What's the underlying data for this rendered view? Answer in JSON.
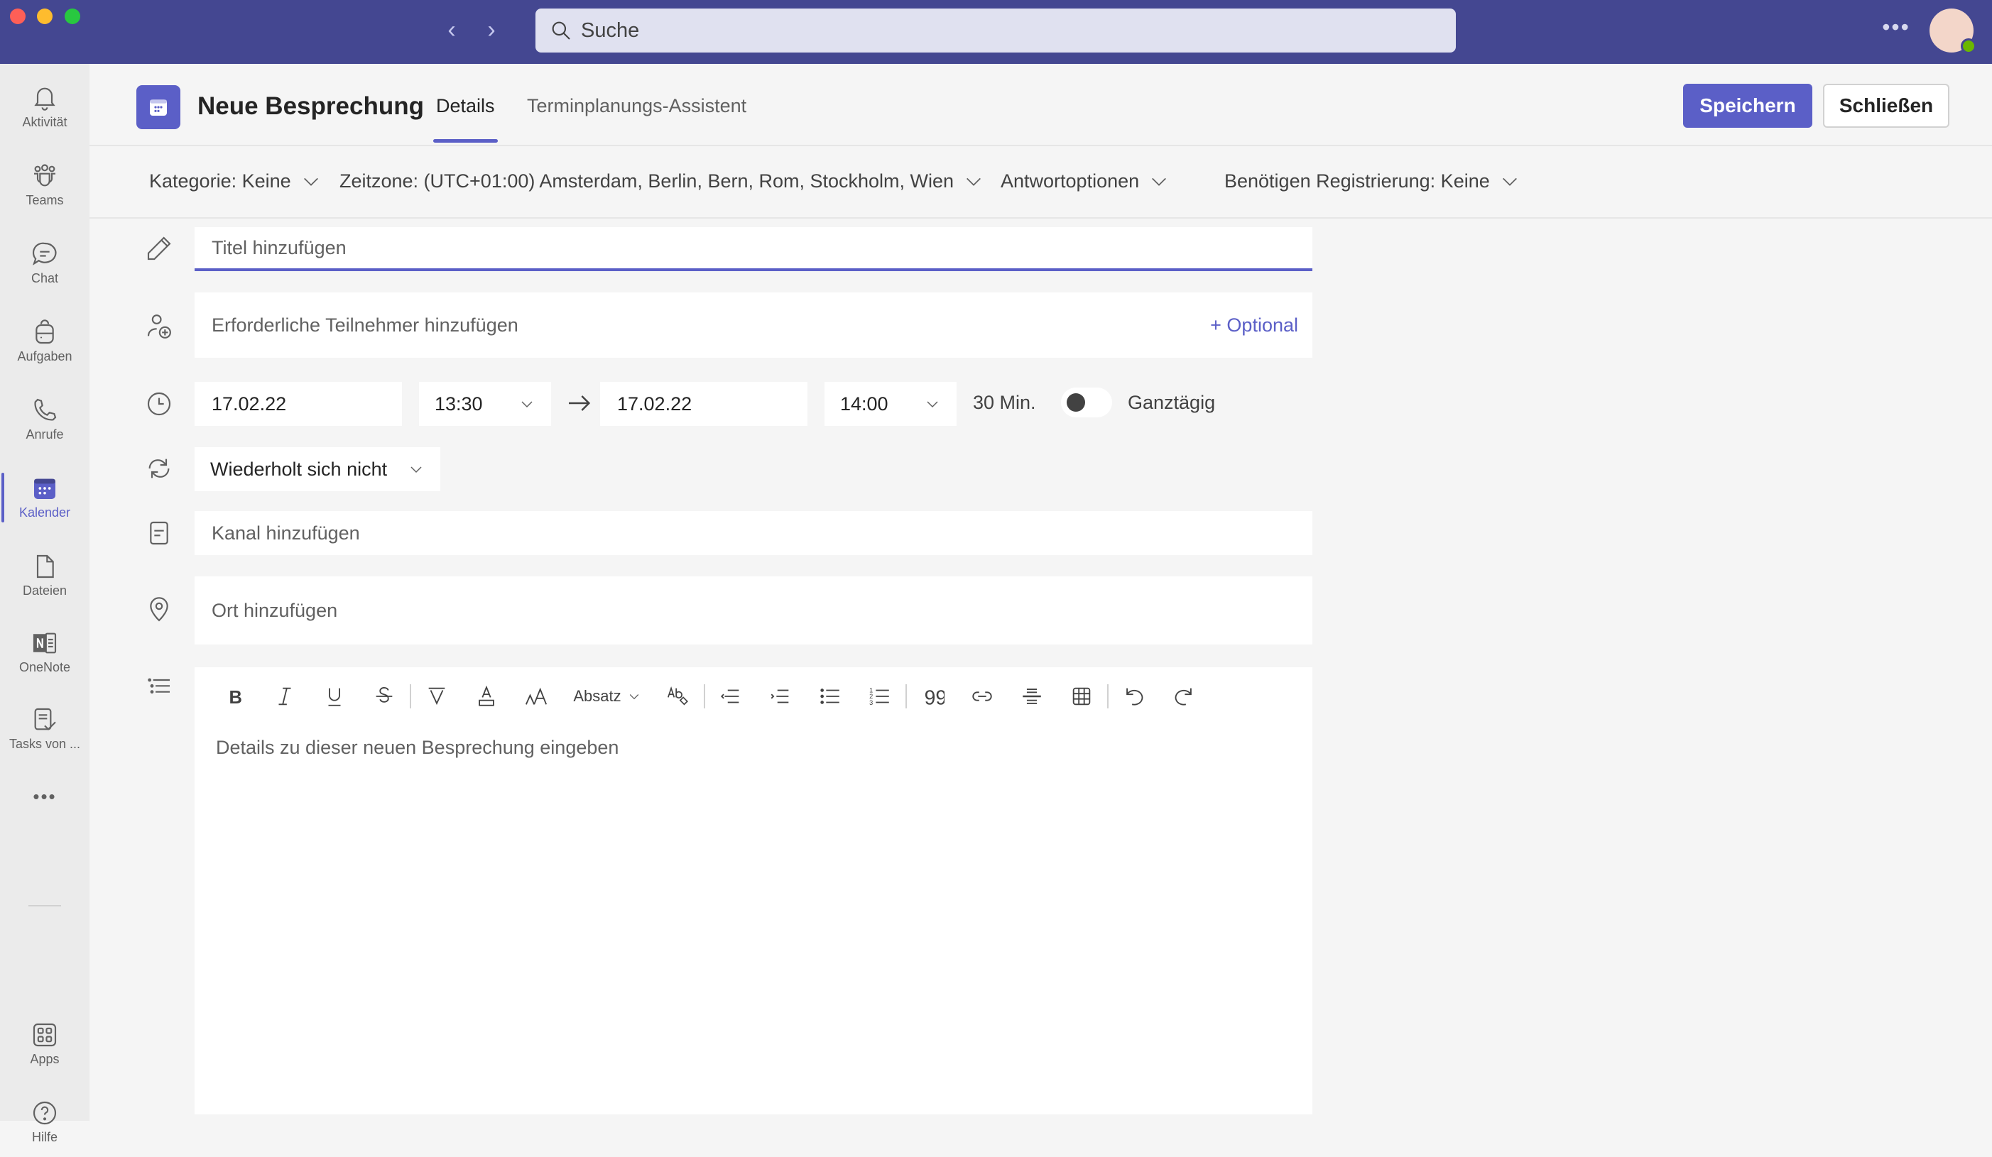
{
  "titlebar": {
    "search_placeholder": "Suche",
    "more_label": "•••",
    "nav_back": "‹",
    "nav_forward": "›",
    "accent_color": "#444791"
  },
  "rail": {
    "items": [
      {
        "label": "Aktivität",
        "icon": "bell-icon"
      },
      {
        "label": "Teams",
        "icon": "teams-icon"
      },
      {
        "label": "Chat",
        "icon": "chat-icon"
      },
      {
        "label": "Aufgaben",
        "icon": "backpack-icon"
      },
      {
        "label": "Anrufe",
        "icon": "phone-icon"
      },
      {
        "label": "Kalender",
        "icon": "calendar-icon",
        "active": true
      },
      {
        "label": "Dateien",
        "icon": "file-icon"
      },
      {
        "label": "OneNote",
        "icon": "onenote-icon"
      },
      {
        "label": "Tasks von ...",
        "icon": "tasks-icon"
      }
    ],
    "more_label": "•••",
    "bottom_items": [
      {
        "label": "Apps",
        "icon": "apps-icon"
      },
      {
        "label": "Hilfe",
        "icon": "help-icon"
      }
    ]
  },
  "header": {
    "title": "Neue Besprechung",
    "tabs": [
      {
        "label": "Details",
        "active": true
      },
      {
        "label": "Terminplanungs-Assistent",
        "active": false
      }
    ],
    "save_label": "Speichern",
    "close_label": "Schließen",
    "primary_color": "#5b5fc7"
  },
  "options": {
    "category": "Kategorie: Keine",
    "timezone": "Zeitzone: (UTC+01:00) Amsterdam, Berlin, Bern, Rom, Stockholm, Wien",
    "response": "Antwortoptionen",
    "registration": "Benötigen Registrierung: Keine"
  },
  "form": {
    "title_placeholder": "Titel hinzufügen",
    "attendees_placeholder": "Erforderliche Teilnehmer hinzufügen",
    "optional_label": "+ Optional",
    "start_date": "17.02.22",
    "start_time": "13:30",
    "end_date": "17.02.22",
    "end_time": "14:00",
    "duration": "30 Min.",
    "all_day_label": "Ganztägig",
    "all_day_on": false,
    "recurrence": "Wiederholt sich nicht",
    "channel_placeholder": "Kanal hinzufügen",
    "location_placeholder": "Ort hinzufügen"
  },
  "editor": {
    "paragraph_label": "Absatz",
    "placeholder": "Details zu dieser neuen Besprechung eingeben"
  }
}
